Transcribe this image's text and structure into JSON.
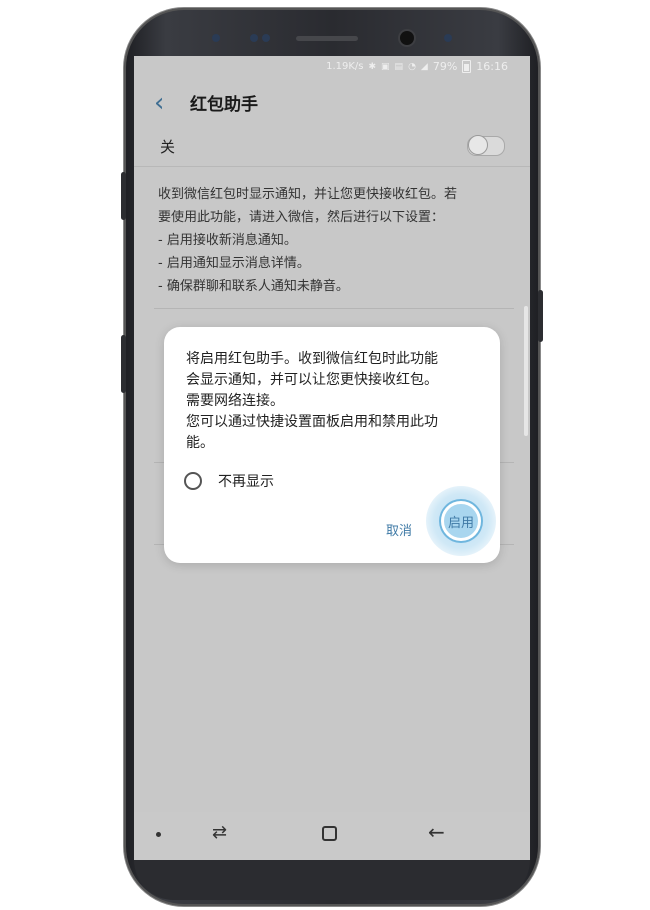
{
  "status_bar": {
    "net_speed": "1.19K/s",
    "icons": [
      "bluetooth-icon",
      "nfc-icon",
      "vibrate-icon",
      "wifi-icon",
      "signal-icon"
    ],
    "battery": "79%",
    "time": "16:16"
  },
  "header": {
    "title": "红包助手",
    "back_icon": "chevron-left-icon"
  },
  "toggle": {
    "label": "关",
    "state": "off"
  },
  "description": {
    "lines": [
      "收到微信红包时显示通知，并让您更快接收红包。若",
      "要使用此功能，请进入微信，然后进行以下设置：",
      "- 启用接收新消息通知。",
      "- 启用通知显示消息详情。",
      "- 确保群聊和联系人通知未静音。"
    ]
  },
  "dialog": {
    "lines": [
      "将启用红包助手。收到微信红包时此功能",
      "会显示通知，并可以让您更快接收红包。",
      "需要网络连接。",
      "您可以通过快捷设置面板启用和禁用此功",
      "能。"
    ],
    "checkbox_label": "不再显示",
    "cancel_label": "取消",
    "enable_label": "启用"
  },
  "nav_bar": {
    "icons": [
      "dot-icon",
      "recent-apps-icon",
      "home-icon",
      "back-icon"
    ]
  },
  "colors": {
    "accent": "#3f7aa6",
    "screen_dim": "#c8c8c8",
    "tap_highlight": "#a9d6ef"
  }
}
